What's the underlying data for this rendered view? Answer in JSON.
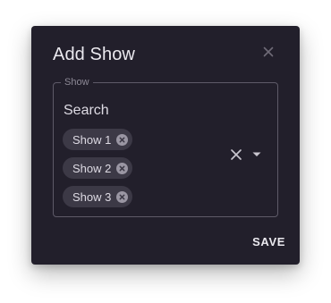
{
  "dialog": {
    "title": "Add Show",
    "close_icon": "close-icon",
    "save_label": "SAVE"
  },
  "field": {
    "legend": "Show",
    "input_text": "Search",
    "chips": [
      {
        "label": "Show 1",
        "icon": "cancel-circle-icon"
      },
      {
        "label": "Show 2",
        "icon": "cancel-circle-icon"
      },
      {
        "label": "Show 3",
        "icon": "cancel-circle-icon"
      }
    ],
    "clear_icon": "clear-icon",
    "dropdown_icon": "arrow-drop-down-icon"
  },
  "colors": {
    "dialog_background": "#221f2b",
    "chip_background": "#3c3946",
    "text": "#ebe9ef",
    "border": "#5e5a68"
  }
}
